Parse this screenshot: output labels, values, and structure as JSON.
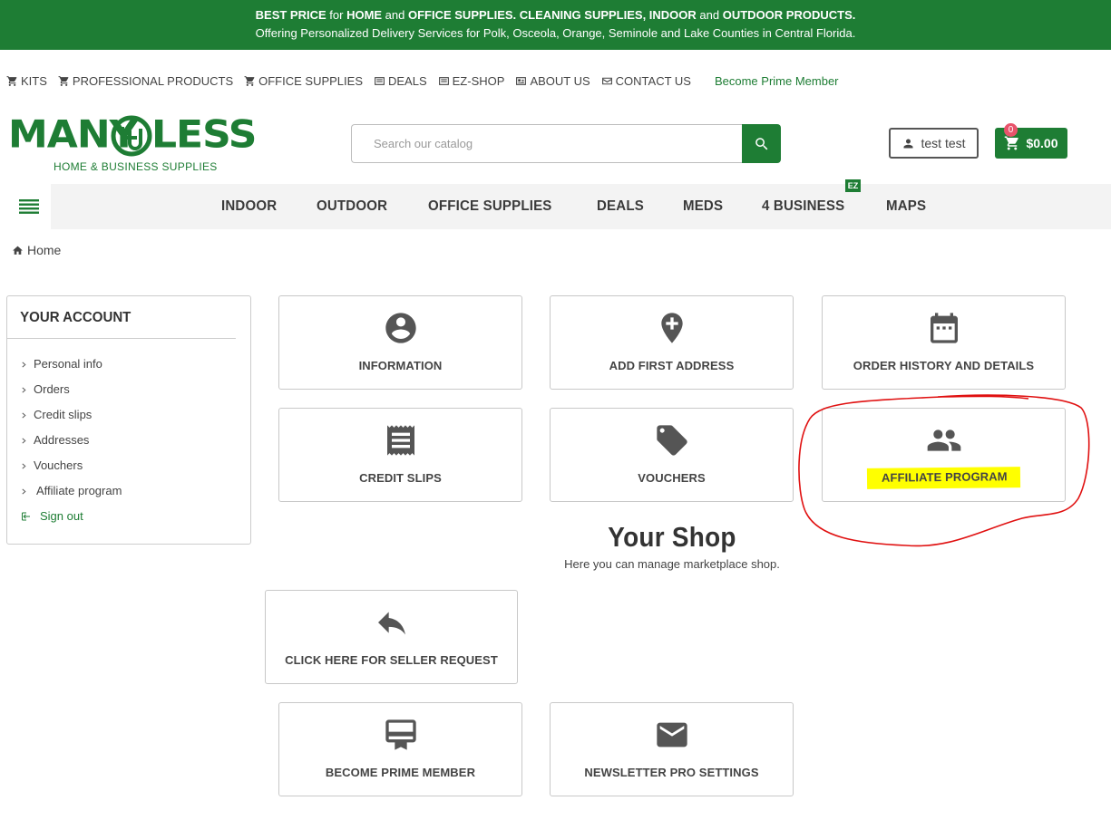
{
  "banner": {
    "line1_a": "BEST PRICE",
    "line1_b": " for ",
    "line1_c": "HOME",
    "line1_d": " and ",
    "line1_e": "OFFICE SUPPLIES. CLEANING SUPPLIES, INDOOR",
    "line1_f": " and ",
    "line1_g": "OUTDOOR PRODUCTS.",
    "line2": "Offering Personalized Delivery Services for Polk, Osceola, Orange, Seminole and Lake Counties in Central Florida."
  },
  "top_links": {
    "kits": "KITS",
    "professional": "PROFESSIONAL PRODUCTS",
    "office": "OFFICE SUPPLIES",
    "deals": "DEALS",
    "ezshop": "EZ-SHOP",
    "about": "ABOUT US",
    "contact": "CONTACT US",
    "prime": "Become Prime Member"
  },
  "logo": {
    "word1": "MANY",
    "word2": "LESS",
    "tagline": "HOME & BUSINESS SUPPLIES"
  },
  "search": {
    "placeholder": "Search our catalog"
  },
  "user": {
    "name": "test test"
  },
  "cart": {
    "total": "$0.00",
    "count": "0"
  },
  "nav": {
    "items": [
      "INDOOR",
      "OUTDOOR",
      "OFFICE SUPPLIES",
      "DEALS",
      "MEDS",
      "4 BUSINESS",
      "MAPS"
    ],
    "badge": "EZ"
  },
  "breadcrumb": {
    "home": "Home"
  },
  "sidebar": {
    "title": "YOUR ACCOUNT",
    "items": [
      "Personal info",
      "Orders",
      "Credit slips",
      "Addresses",
      "Vouchers",
      "Affiliate program"
    ],
    "signout": "Sign out"
  },
  "cards": {
    "information": "INFORMATION",
    "add_address": "ADD FIRST ADDRESS",
    "order_history": "ORDER HISTORY AND DETAILS",
    "credit_slips": "CREDIT SLIPS",
    "vouchers": "VOUCHERS",
    "affiliate": "AFFILIATE PROGRAM",
    "seller_request": "CLICK HERE FOR SELLER REQUEST",
    "prime_member": "BECOME PRIME MEMBER",
    "newsletter": "NEWSLETTER PRO SETTINGS"
  },
  "shop": {
    "title": "Your Shop",
    "subtitle": "Here you can manage marketplace shop."
  },
  "colors": {
    "brand_green": "#1e7d34",
    "highlight_yellow": "#ffff00",
    "annotation_red": "#e01010",
    "cart_badge": "#e8536b"
  }
}
